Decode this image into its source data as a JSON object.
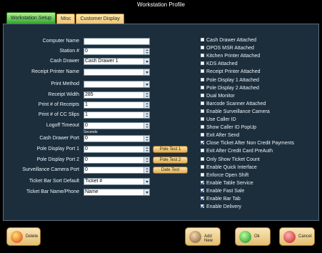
{
  "window": {
    "title": "Workstation Profile"
  },
  "tabs": [
    {
      "label": "Workstation Setup"
    },
    {
      "label": "Misc"
    },
    {
      "label": "Customer Display"
    }
  ],
  "form": {
    "computer_name": {
      "label": "Computer Name",
      "value": ""
    },
    "station_no": {
      "label": "Station #",
      "value": "0"
    },
    "cash_drawer": {
      "label": "Cash Drawer",
      "value": "Cash Drawer 1"
    },
    "receipt_printer_name": {
      "label": "Receipt Printer Name",
      "value": ""
    },
    "print_method": {
      "label": "Print Method",
      "value": ""
    },
    "receipt_width": {
      "label": "Receipt Width",
      "value": "285"
    },
    "print_receipts": {
      "label": "Print # of Receipts",
      "value": "1"
    },
    "print_cc_slips": {
      "label": "Print # of CC Slips",
      "value": "1"
    },
    "logoff_timeout": {
      "label": "Logoff Timeout",
      "value": "0"
    },
    "seconds_label": "Seconds",
    "cash_drawer_port": {
      "label": "Cash Drawer Port",
      "value": "0"
    },
    "pole_display_port_1": {
      "label": "Pole Display Port 1",
      "value": "0"
    },
    "pole_display_port_2": {
      "label": "Pole Display Port 2",
      "value": "0"
    },
    "surveillance_camera_port": {
      "label": "Surveillance Camera Port",
      "value": "0"
    },
    "ticket_bar_sort_default": {
      "label": "Ticket Bar Sort Default",
      "value": "Ticket #"
    },
    "ticket_bar_name_phone": {
      "label": "Ticket Bar Name/Phone",
      "value": "Name"
    }
  },
  "test_buttons": {
    "pole_test_1": "Pole Test 1",
    "pole_test_2": "Pole Test 2",
    "date_test": "Date Test"
  },
  "options": [
    {
      "label": "Cash Drawer Attached",
      "checked": false
    },
    {
      "label": "OPOS MSR Attached",
      "checked": false
    },
    {
      "label": "Kitchen Printer Attached",
      "checked": false
    },
    {
      "label": "KDS Attached",
      "checked": false
    },
    {
      "label": "Receipt Printer Attached",
      "checked": false
    },
    {
      "label": "Pole Display 1 Attached",
      "checked": false
    },
    {
      "label": "Pole Display 2 Attached",
      "checked": false
    },
    {
      "label": "Dual Monitor",
      "checked": false
    },
    {
      "label": "Barcode Scanner Attached",
      "checked": false
    },
    {
      "label": "Enable Surveillance Camera",
      "checked": false
    },
    {
      "label": "Use Caller ID",
      "checked": false
    },
    {
      "label": "Show Caller ID PopUp",
      "checked": false
    },
    {
      "label": "Exit After Send",
      "checked": false
    },
    {
      "label": "Close Ticket After Non Credit Payments",
      "checked": true
    },
    {
      "label": "Exit After Credit Card PreAuth",
      "checked": false
    },
    {
      "label": "Only Show Ticket Count",
      "checked": false
    },
    {
      "label": "Enable Quick Interface",
      "checked": false
    },
    {
      "label": "Enforce Open Shift",
      "checked": false
    },
    {
      "label": "Enable Table Service",
      "checked": true
    },
    {
      "label": "Enable Fast Sale",
      "checked": true
    },
    {
      "label": "Enable Bar Tab",
      "checked": true
    },
    {
      "label": "Enable Delivery",
      "checked": true
    }
  ],
  "footer": {
    "delete_label": "Delete",
    "add_new_label": "Add New",
    "ok_label": "Ok",
    "cancel_label": "Cancel"
  },
  "colors": {
    "panel_bg": "#1c2e3c",
    "button_gold": "#e5bf6f",
    "active_tab_green": "#2ea52e"
  }
}
